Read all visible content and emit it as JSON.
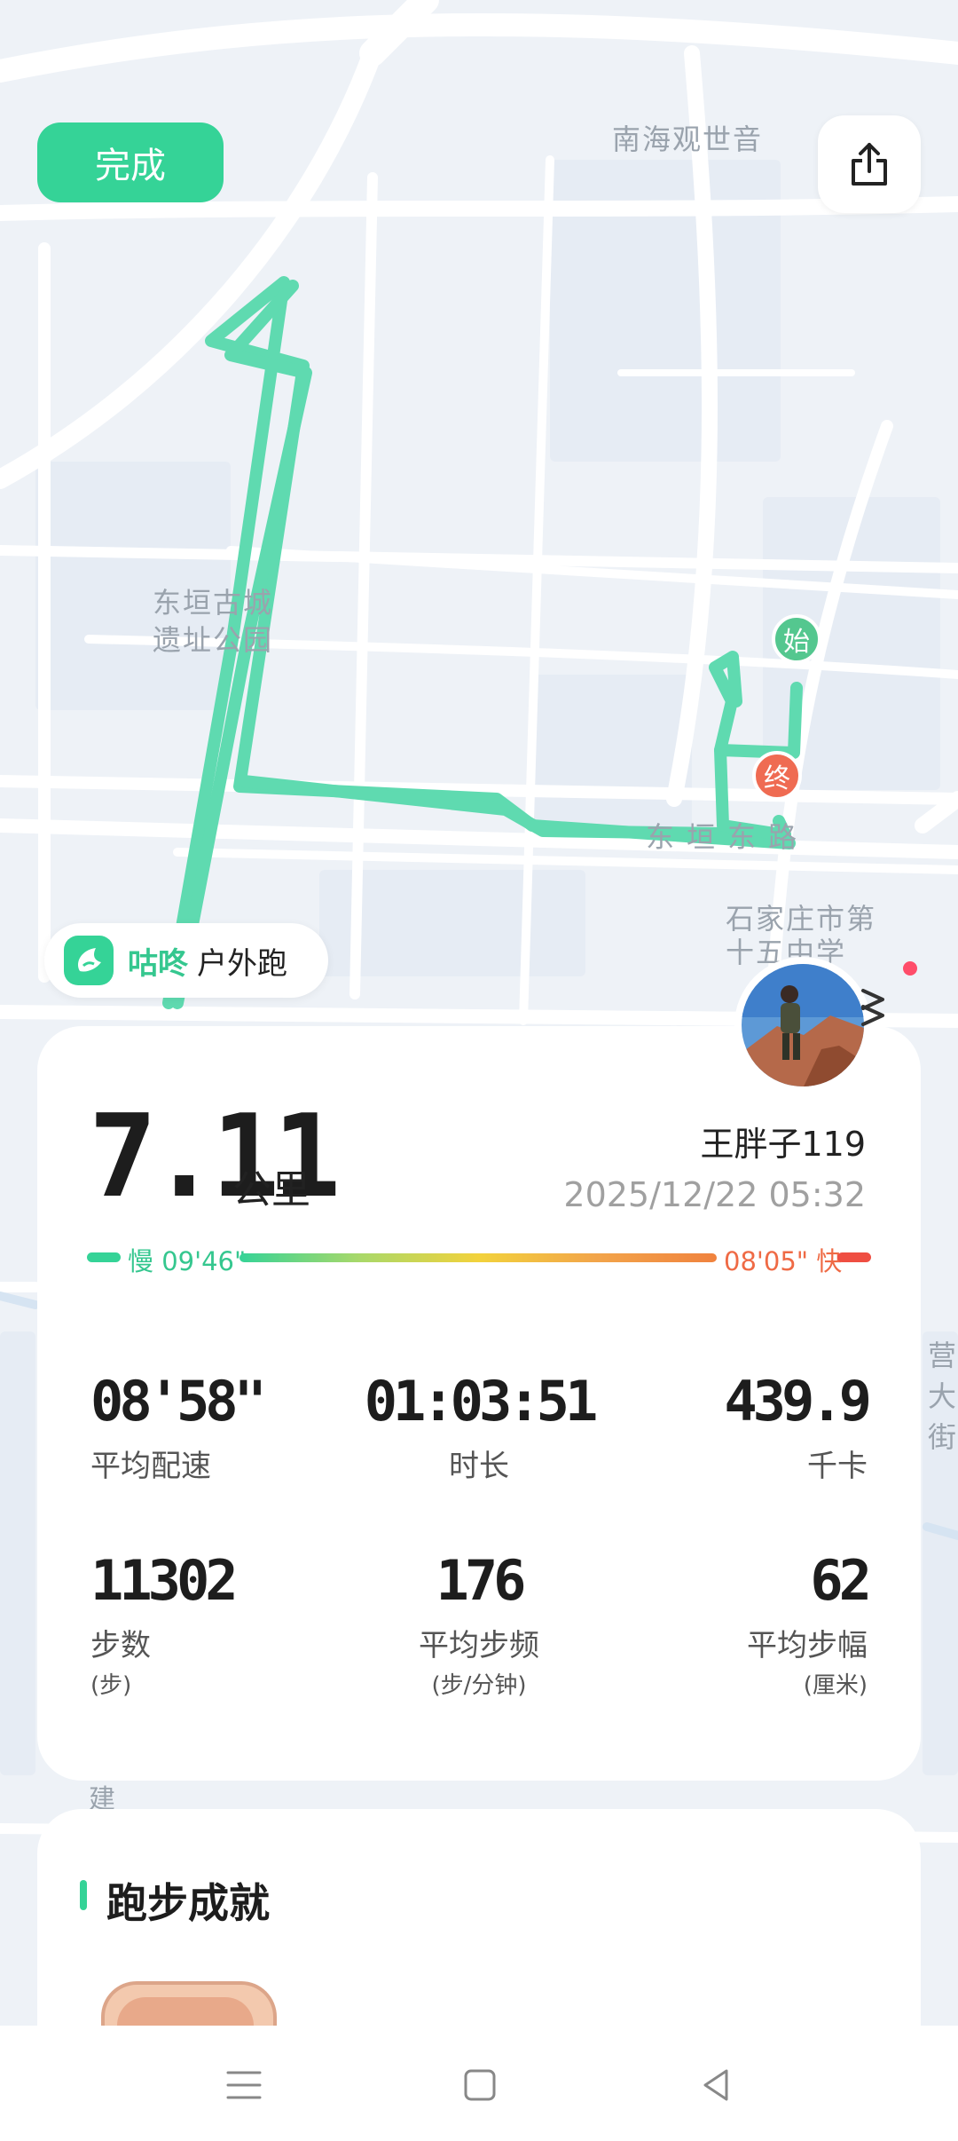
{
  "map": {
    "labels": {
      "nanhai": "南海观世音",
      "donghuan_1": "东垣古城",
      "donghuan_2": "遗址公园",
      "road": "东垣东路",
      "school_1": "石家庄市第",
      "school_2": "十五中学",
      "side_1": "营",
      "side_2": "大",
      "side_3": "街",
      "bottom": "建"
    },
    "start_marker": "始",
    "end_marker": "终",
    "route_color": "#5fdab0"
  },
  "header": {
    "done_label": "完成",
    "share_icon": "share-icon"
  },
  "brand": {
    "name": "咕咚",
    "activity": "户外跑",
    "accent": "#35d397"
  },
  "summary": {
    "distance": "7.11",
    "distance_unit": "公里",
    "username": "王胖子119",
    "datetime": "2025/12/22 05:32",
    "pace_slow_label": "慢 09'46\"",
    "pace_fast_label": "08'05\" 快"
  },
  "stats": [
    {
      "value": "08'58\"",
      "label": "平均配速",
      "sub": ""
    },
    {
      "value": "01:03:51",
      "label": "时长",
      "sub": ""
    },
    {
      "value": "439.9",
      "label": "千卡",
      "sub": ""
    },
    {
      "value": "11302",
      "label": "步数",
      "sub": "(步)"
    },
    {
      "value": "176",
      "label": "平均步频",
      "sub": "(步/分钟)"
    },
    {
      "value": "62",
      "label": "平均步幅",
      "sub": "(厘米)"
    }
  ],
  "achievements": {
    "title": "跑步成就"
  },
  "nav": {
    "menu": "menu-icon",
    "home": "home-icon",
    "back": "back-icon"
  }
}
